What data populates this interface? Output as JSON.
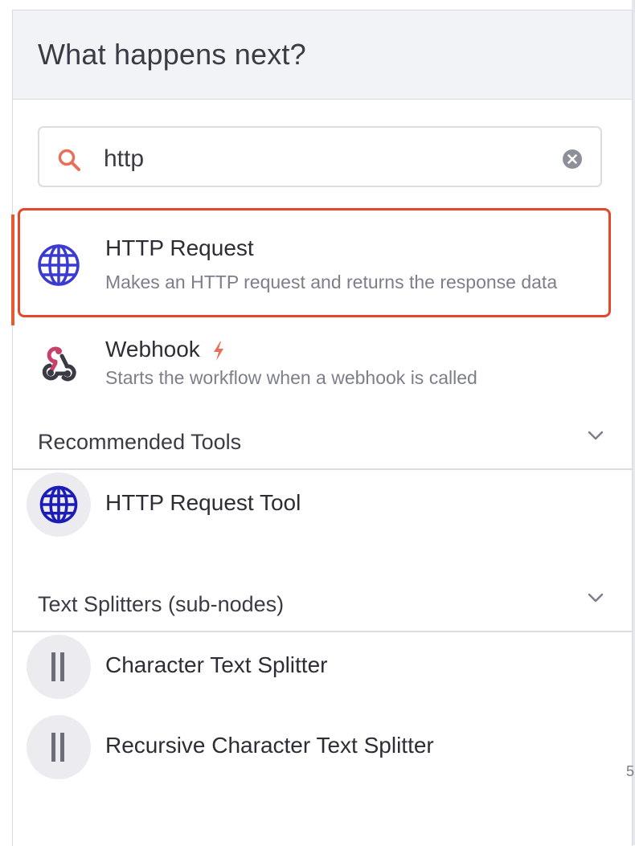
{
  "header": {
    "title": "What happens next?"
  },
  "search": {
    "value": "http",
    "icon": "search-icon",
    "clear_icon": "clear-icon"
  },
  "results": [
    {
      "title": "HTTP Request",
      "description": "Makes an HTTP request and returns the response data",
      "icon": "globe-icon",
      "selected": true
    },
    {
      "title": "Webhook",
      "description": "Starts the workflow when a webhook is called",
      "icon": "webhook-icon",
      "badge_icon": "bolt-icon"
    }
  ],
  "sections": [
    {
      "label": "Recommended Tools",
      "items": [
        {
          "name": "HTTP Request Tool",
          "icon": "globe-icon"
        }
      ]
    },
    {
      "label": "Text Splitters (sub-nodes)",
      "items": [
        {
          "name": "Character Text Splitter",
          "icon": "splitter-icon"
        },
        {
          "name": "Recursive Character Text Splitter",
          "icon": "splitter-icon"
        }
      ]
    }
  ],
  "edge_glyph": "5",
  "colors": {
    "accent": "#e5472a",
    "globe": "#2f2fc8",
    "bolt": "#e8705a"
  }
}
